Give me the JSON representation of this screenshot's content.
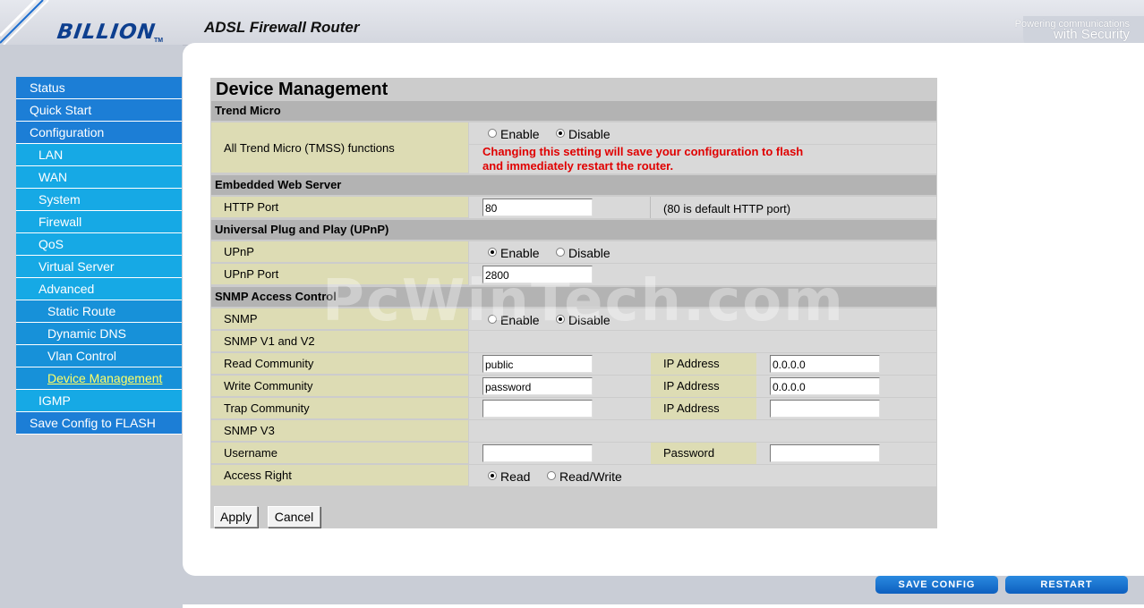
{
  "header": {
    "logo": "BILLION",
    "logo_tm": "TM",
    "title": "ADSL Firewall Router",
    "tagline_line1": "Powering communications",
    "tagline_line2": "with Security"
  },
  "sidebar": {
    "items": [
      {
        "label": "Status"
      },
      {
        "label": "Quick Start"
      },
      {
        "label": "Configuration"
      },
      {
        "label": "LAN"
      },
      {
        "label": "WAN"
      },
      {
        "label": "System"
      },
      {
        "label": "Firewall"
      },
      {
        "label": "QoS"
      },
      {
        "label": "Virtual Server"
      },
      {
        "label": "Advanced"
      },
      {
        "label": "Static Route"
      },
      {
        "label": "Dynamic DNS"
      },
      {
        "label": "Vlan Control"
      },
      {
        "label": "Device Management"
      },
      {
        "label": "IGMP"
      },
      {
        "label": "Save Config to FLASH"
      }
    ]
  },
  "page": {
    "title": "Device Management",
    "trend_micro": {
      "section": "Trend Micro",
      "label": "All Trend Micro (TMSS) functions",
      "enable": "Enable",
      "disable": "Disable",
      "selected": "Disable",
      "warning_line1": "Changing this setting will save your configuration to flash",
      "warning_line2": "and immediately restart the router."
    },
    "web_server": {
      "section": "Embedded Web Server",
      "http_port_label": "HTTP Port",
      "http_port_value": "80",
      "http_port_hint": "(80 is default HTTP port)"
    },
    "upnp": {
      "section": "Universal Plug and Play (UPnP)",
      "label": "UPnP",
      "enable": "Enable",
      "disable": "Disable",
      "selected": "Enable",
      "port_label": "UPnP Port",
      "port_value": "2800"
    },
    "snmp": {
      "section": "SNMP Access Control",
      "label": "SNMP",
      "enable": "Enable",
      "disable": "Disable",
      "selected": "Disable",
      "v1v2_label": "SNMP V1 and V2",
      "read_community_label": "Read Community",
      "read_community_value": "public",
      "write_community_label": "Write Community",
      "write_community_value": "password",
      "trap_community_label": "Trap Community",
      "trap_community_value": "",
      "ip_label": "IP Address",
      "read_ip": "0.0.0.0",
      "write_ip": "0.0.0.0",
      "trap_ip": "",
      "v3_label": "SNMP V3",
      "username_label": "Username",
      "username_value": "",
      "password_label": "Password",
      "password_value": "",
      "access_label": "Access Right",
      "read": "Read",
      "read_write": "Read/Write",
      "access_selected": "Read"
    },
    "apply": "Apply",
    "cancel": "Cancel"
  },
  "footer": {
    "save_config": "SAVE CONFIG",
    "restart": "RESTART"
  },
  "watermark": "PcWinTech.com"
}
